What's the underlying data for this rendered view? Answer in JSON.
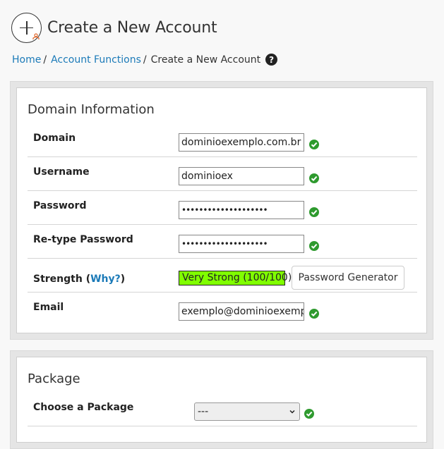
{
  "header": {
    "title": "Create a New Account",
    "icon": "add-account-icon"
  },
  "breadcrumb": {
    "items": [
      {
        "label": "Home"
      },
      {
        "label": "Account Functions"
      }
    ],
    "current": "Create a New Account",
    "help_icon": "question-circle-icon",
    "help_glyph": "?"
  },
  "domain_section": {
    "title": "Domain Information",
    "domain": {
      "label": "Domain",
      "value": "dominioexemplo.com.br"
    },
    "username": {
      "label": "Username",
      "value": "dominioex"
    },
    "password": {
      "label": "Password",
      "value": "••••••••••••••••••••"
    },
    "retype_password": {
      "label": "Re-type Password",
      "value": "••••••••••••••••••••"
    },
    "strength": {
      "label": "Strength (",
      "why": "Why?",
      "close": ")",
      "value": "Very Strong (100/100)",
      "score": 100,
      "color": "#80ff00"
    },
    "generator_button": "Password Generator",
    "email": {
      "label": "Email",
      "value": "exemplo@dominioexemplo"
    }
  },
  "package_section": {
    "title": "Package",
    "choose": {
      "label": "Choose a Package",
      "selected": "---"
    }
  },
  "colors": {
    "valid": "#2e9a2e",
    "link": "#1b7ab8"
  }
}
